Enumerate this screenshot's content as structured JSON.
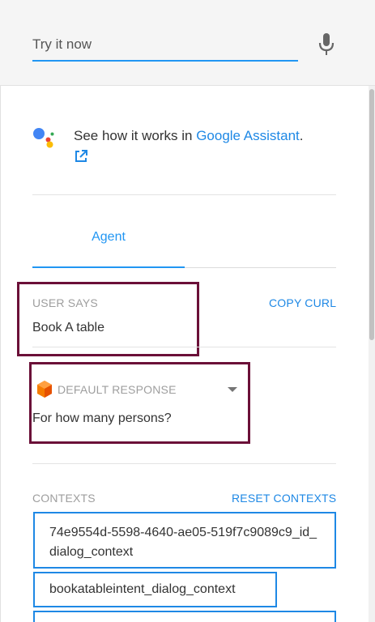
{
  "try_it": {
    "placeholder": "Try it now"
  },
  "google_assistant": {
    "text": "See how it works in ",
    "link": "Google Assistant",
    "suffix": "."
  },
  "tabs": [
    {
      "label": "Agent",
      "active": true
    }
  ],
  "user_says": {
    "label": "USER SAYS",
    "value": "Book A table",
    "copy_curl": "COPY CURL"
  },
  "response": {
    "label": "DEFAULT RESPONSE",
    "value": "For how many persons?"
  },
  "contexts": {
    "label": "CONTEXTS",
    "reset": "RESET CONTEXTS",
    "items": [
      "74e9554d-5598-4640-ae05-519f7c9089c9_id_dialog_context",
      "bookatableintent_dialog_context"
    ]
  },
  "colors": {
    "accent": "#2196f3",
    "highlight": "#6b1038",
    "response_icon": "#f57c00"
  },
  "icons": {
    "mic": "microphone-icon",
    "assistant": "google-assistant-icon",
    "external": "external-link-icon",
    "response": "response-icon",
    "caret": "caret-down-icon"
  }
}
